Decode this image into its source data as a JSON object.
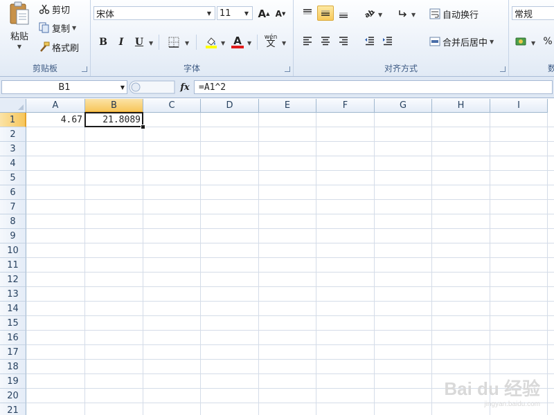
{
  "ribbon": {
    "clipboard": {
      "paste_label": "粘贴",
      "cut_label": "剪切",
      "copy_label": "复制",
      "format_painter_label": "格式刷",
      "group_label": "剪贴板"
    },
    "font": {
      "font_name": "宋体",
      "font_size": "11",
      "bold": "B",
      "italic": "I",
      "underline": "U",
      "grow_font": "A",
      "shrink_font": "A",
      "font_color_letter": "A",
      "phonetic": "wén",
      "group_label": "字体"
    },
    "alignment": {
      "wrap_text_label": "自动换行",
      "merge_center_label": "合并后居中",
      "group_label": "对齐方式"
    },
    "number": {
      "format_value": "常规",
      "percent": "%",
      "group_label": "数"
    }
  },
  "formula_bar": {
    "name_box": "B1",
    "fx_label": "fx",
    "formula": "=A1^2"
  },
  "sheet": {
    "columns": [
      "A",
      "B",
      "C",
      "D",
      "E",
      "F",
      "G",
      "H",
      "I"
    ],
    "rows": [
      "1",
      "2",
      "3",
      "4",
      "5",
      "6",
      "7",
      "8",
      "9",
      "10",
      "11",
      "12",
      "13",
      "14",
      "15",
      "16",
      "17",
      "18",
      "19",
      "20",
      "21"
    ],
    "cells": {
      "A1": "4.67",
      "B1": "21.8089"
    },
    "active_cell": "B1"
  },
  "watermark": {
    "text": "Bai du 经验",
    "sub": "jingyan.baidu.com"
  },
  "colors": {
    "selection_header": "#f7c65b",
    "ribbon_bg": "#eef3fa",
    "grid_line": "#d4dce8"
  }
}
